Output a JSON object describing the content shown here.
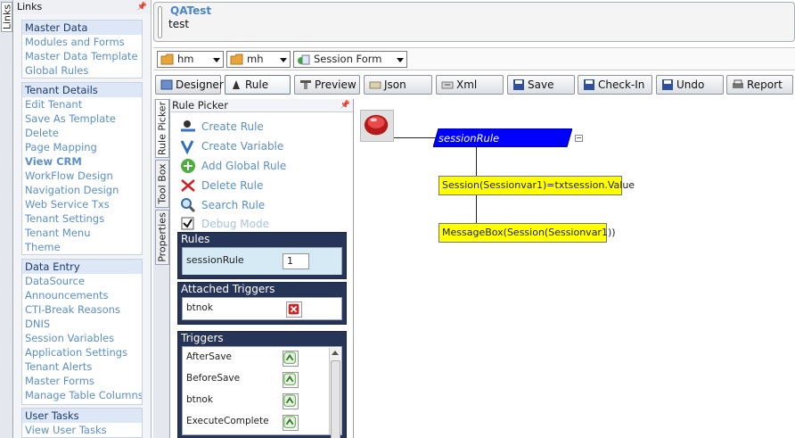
{
  "links_tab": {
    "label": "Links"
  },
  "links_panel": {
    "title": "Links",
    "groups": [
      {
        "title": "Master Data",
        "items": [
          "Modules and Forms",
          "Master Data Template",
          "Global Rules"
        ]
      },
      {
        "title": "Tenant Details",
        "items": [
          "Edit Tenant",
          "Save As Template",
          "Delete",
          "Page Mapping",
          "View CRM",
          "WorkFlow Design",
          "Navigation Design",
          "Web Service Txs",
          "Tenant Settings",
          "Tenant Menu",
          "Theme"
        ]
      },
      {
        "title": "Data Entry",
        "items": [
          "DataSource",
          "Announcements",
          "CTI-Break Reasons",
          "DNIS",
          "Session Variables",
          "Application Settings",
          "Tenant Alerts",
          "Master Forms",
          "Manage Table Columns"
        ]
      },
      {
        "title": "User Tasks",
        "items": [
          "View User Tasks"
        ]
      }
    ]
  },
  "header": {
    "title": "QATest",
    "subtitle": "test"
  },
  "dropdowns": [
    {
      "value": "hm",
      "icon": "folder-icon"
    },
    {
      "value": "mh",
      "icon": "folder-icon"
    },
    {
      "value": "Session Form",
      "icon": "form-icon"
    }
  ],
  "toolbar": {
    "buttons": [
      {
        "label": "Designer",
        "icon": "designer-icon"
      },
      {
        "label": "Rule",
        "icon": "rule-icon"
      },
      {
        "label": "Preview",
        "icon": "preview-icon"
      },
      {
        "label": "Json",
        "icon": "json-icon"
      },
      {
        "label": "Xml",
        "icon": "xml-icon"
      },
      {
        "label": "Save",
        "icon": "save-icon"
      },
      {
        "label": "Check-In",
        "icon": "check-in-icon"
      },
      {
        "label": "Undo",
        "icon": "undo-icon"
      },
      {
        "label": "Report",
        "icon": "report-icon"
      }
    ]
  },
  "side_tabs": [
    "Rule Picker",
    "Tool Box",
    "Properties"
  ],
  "rule_picker": {
    "title": "Rule Picker",
    "actions": [
      {
        "label": "Create Rule",
        "icon": "create-rule-icon"
      },
      {
        "label": "Create Variable",
        "icon": "variable-icon"
      },
      {
        "label": "Add Global Rule",
        "icon": "globe-icon"
      },
      {
        "label": "Delete Rule",
        "icon": "scissors-icon"
      },
      {
        "label": "Search Rule",
        "icon": "magnifier-icon"
      },
      {
        "label": "Debug Mode",
        "icon": "checkbox-icon"
      }
    ],
    "rules": {
      "title": "Rules",
      "items": [
        {
          "name": "sessionRule",
          "order": "1"
        }
      ]
    },
    "attached_triggers": {
      "title": "Attached Triggers",
      "items": [
        "btnok"
      ]
    },
    "triggers": {
      "title": "Triggers",
      "items": [
        "AfterSave",
        "BeforeSave",
        "btnok",
        "ExecuteComplete"
      ]
    }
  },
  "canvas": {
    "rule_name": "sessionRule",
    "nodes": [
      "Session(Sessionvar1)=txtsession.Value",
      "MessageBox(Session(Sessionvar1))"
    ],
    "collapse_symbol": "−"
  },
  "colors": {
    "rule_header": "#0000ff",
    "node_fill": "#ffff00",
    "panel_dark": "#263457",
    "link": "#5b8fc8"
  }
}
